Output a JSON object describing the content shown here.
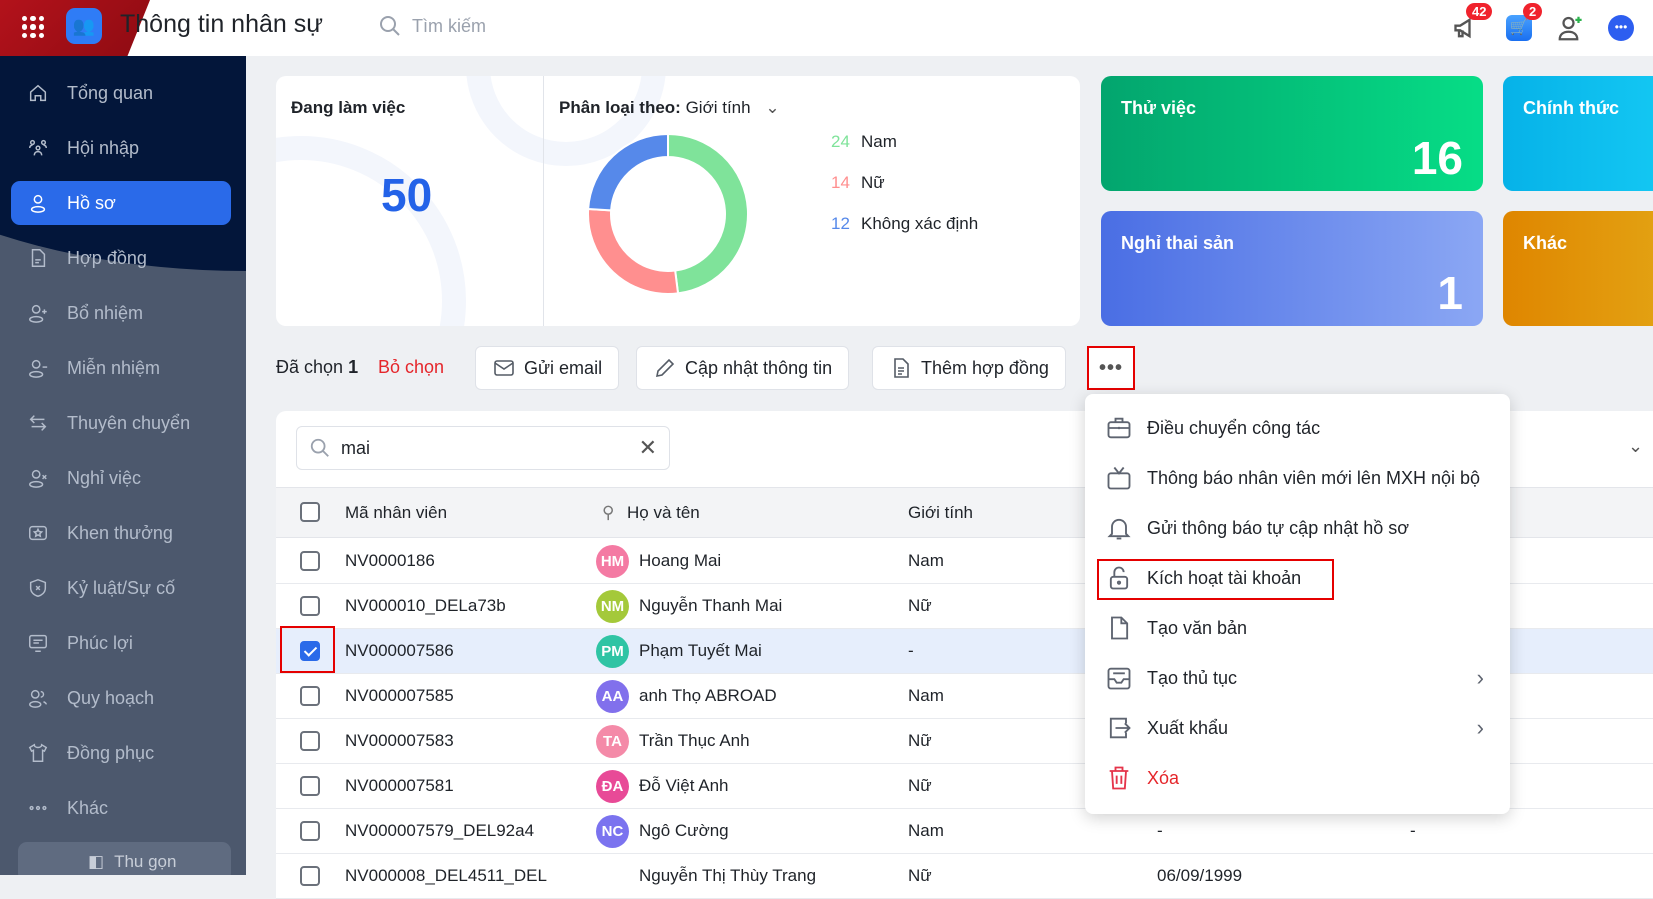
{
  "header": {
    "title": "Thông tin nhân sự",
    "search_placeholder": "Tìm kiếm",
    "notif_count": "42",
    "cart_count": "2"
  },
  "sidebar": {
    "items": [
      {
        "label": "Tổng quan",
        "icon": "home-icon"
      },
      {
        "label": "Hội nhập",
        "icon": "group-icon"
      },
      {
        "label": "Hồ sơ",
        "icon": "user-icon",
        "active": true
      },
      {
        "label": "Hợp đồng",
        "icon": "document-icon"
      },
      {
        "label": "Bổ nhiệm",
        "icon": "user-plus-icon"
      },
      {
        "label": "Miễn nhiệm",
        "icon": "user-minus-icon"
      },
      {
        "label": "Thuyên chuyển",
        "icon": "transfer-icon"
      },
      {
        "label": "Nghỉ việc",
        "icon": "user-x-icon"
      },
      {
        "label": "Khen thưởng",
        "icon": "reward-icon"
      },
      {
        "label": "Kỷ luật/Sự cố",
        "icon": "shield-icon"
      },
      {
        "label": "Phúc lợi",
        "icon": "benefit-icon"
      },
      {
        "label": "Quy hoạch",
        "icon": "users-icon"
      },
      {
        "label": "Đồng phục",
        "icon": "shirt-icon"
      },
      {
        "label": "Khác",
        "icon": "dots-icon"
      }
    ],
    "collapse_label": "Thu gọn"
  },
  "stats": {
    "working_label": "Đang làm việc",
    "working_value": "50",
    "classify_label": "Phân loại theo:",
    "classify_value": "Giới tính",
    "cards": [
      {
        "label": "Thử việc",
        "value": "16"
      },
      {
        "label": "Chính thức",
        "value": ""
      },
      {
        "label": "Nghỉ thai sản",
        "value": "1"
      },
      {
        "label": "Khác",
        "value": ""
      }
    ]
  },
  "chart_data": {
    "type": "pie",
    "title": "Phân loại theo: Giới tính",
    "categories": [
      "Nam",
      "Nữ",
      "Không xác định"
    ],
    "values": [
      24,
      14,
      12
    ],
    "colors": [
      "#7fe39a",
      "#ff8f8f",
      "#5689ea"
    ]
  },
  "actions": {
    "selected_label": "Đã chọn",
    "selected_count": "1",
    "unselect": "Bỏ chọn",
    "send_email": "Gửi email",
    "update_info": "Cập nhật thông tin",
    "add_contract": "Thêm hợp đồng",
    "more": "•••"
  },
  "table": {
    "search_value": "mai",
    "columns": [
      "Mã nhân viên",
      "Họ và tên",
      "Giới tính"
    ],
    "rows": [
      {
        "id": "NV0000186",
        "initials": "HM",
        "name": "Hoang Mai",
        "gender": "Nam",
        "color": "#f47aa3",
        "c4": "",
        "c5": ""
      },
      {
        "id": "NV000010_DELa73b",
        "initials": "NM",
        "name": "Nguyễn Thanh Mai",
        "gender": "Nữ",
        "color": "#a4c93a",
        "c4": "",
        "c5": ""
      },
      {
        "id": "NV000007586",
        "initials": "PM",
        "name": "Phạm Tuyết Mai",
        "gender": "-",
        "color": "#2fc4a4",
        "c4": "",
        "c5": "",
        "selected": true
      },
      {
        "id": "NV000007585",
        "initials": "AA",
        "name": "anh Thọ ABROAD",
        "gender": "Nam",
        "color": "#8170ec",
        "c4": "",
        "c5": ""
      },
      {
        "id": "NV000007583",
        "initials": "TA",
        "name": "Trần Thục Anh",
        "gender": "Nữ",
        "color": "#f48aa8",
        "c4": "",
        "c5": ""
      },
      {
        "id": "NV000007581",
        "initials": "ĐA",
        "name": "Đỗ Việt Anh",
        "gender": "Nữ",
        "color": "#e84a97",
        "c4": "",
        "c5": ""
      },
      {
        "id": "NV000007579_DEL92a4",
        "initials": "NC",
        "name": "Ngô Cường",
        "gender": "Nam",
        "color": "#7b73ef",
        "c4": "-",
        "c5": "-"
      },
      {
        "id": "NV000008_DEL4511_DEL",
        "initials": "",
        "name": "Nguyễn Thị Thùy Trang",
        "gender": "Nữ",
        "color": "#ffffff",
        "c4": "06/09/1999",
        "c5": ""
      }
    ]
  },
  "menu": {
    "items": [
      {
        "label": "Điều chuyển công tác",
        "icon": "briefcase-icon"
      },
      {
        "label": "Thông báo nhân viên mới lên MXH nội bộ",
        "icon": "tv-icon"
      },
      {
        "label": "Gửi thông báo tự cập nhật hồ sơ",
        "icon": "bell-icon"
      },
      {
        "label": "Kích hoạt tài khoản",
        "icon": "unlock-icon"
      },
      {
        "label": "Tạo văn bản",
        "icon": "file-icon"
      },
      {
        "label": "Tạo thủ tục",
        "icon": "inbox-icon",
        "submenu": true
      },
      {
        "label": "Xuất khẩu",
        "icon": "export-icon",
        "submenu": true
      },
      {
        "label": "Xóa",
        "icon": "trash-icon",
        "danger": true
      }
    ]
  }
}
